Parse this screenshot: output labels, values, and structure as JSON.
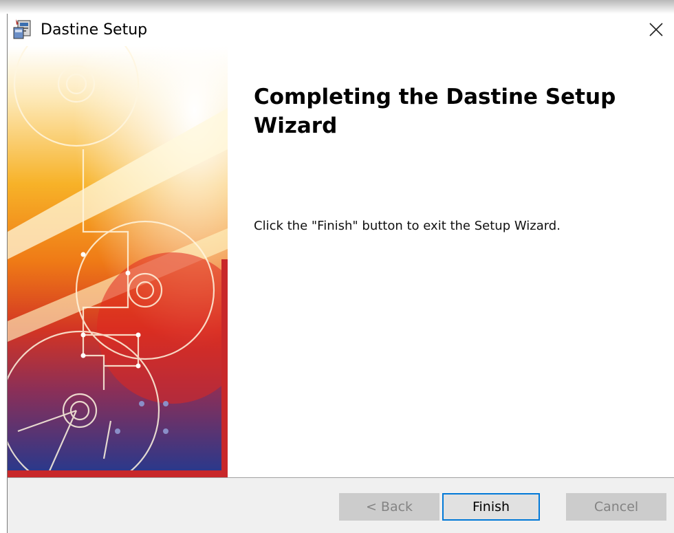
{
  "window": {
    "title": "Dastine Setup",
    "app_icon": "installer-icon",
    "close_icon": "close-icon"
  },
  "main": {
    "heading": "Completing the Dastine Setup Wizard",
    "message": "Click the \"Finish\" button to exit the Setup Wizard."
  },
  "buttons": {
    "back": {
      "label": "< Back",
      "enabled": false
    },
    "finish": {
      "label": "Finish",
      "enabled": true,
      "focused": true
    },
    "cancel": {
      "label": "Cancel",
      "enabled": false
    }
  },
  "colors": {
    "accent": "#0078d7",
    "banner_orange": "#f5a21b",
    "banner_red": "#c8282a",
    "banner_blue": "#2a3a8c"
  }
}
